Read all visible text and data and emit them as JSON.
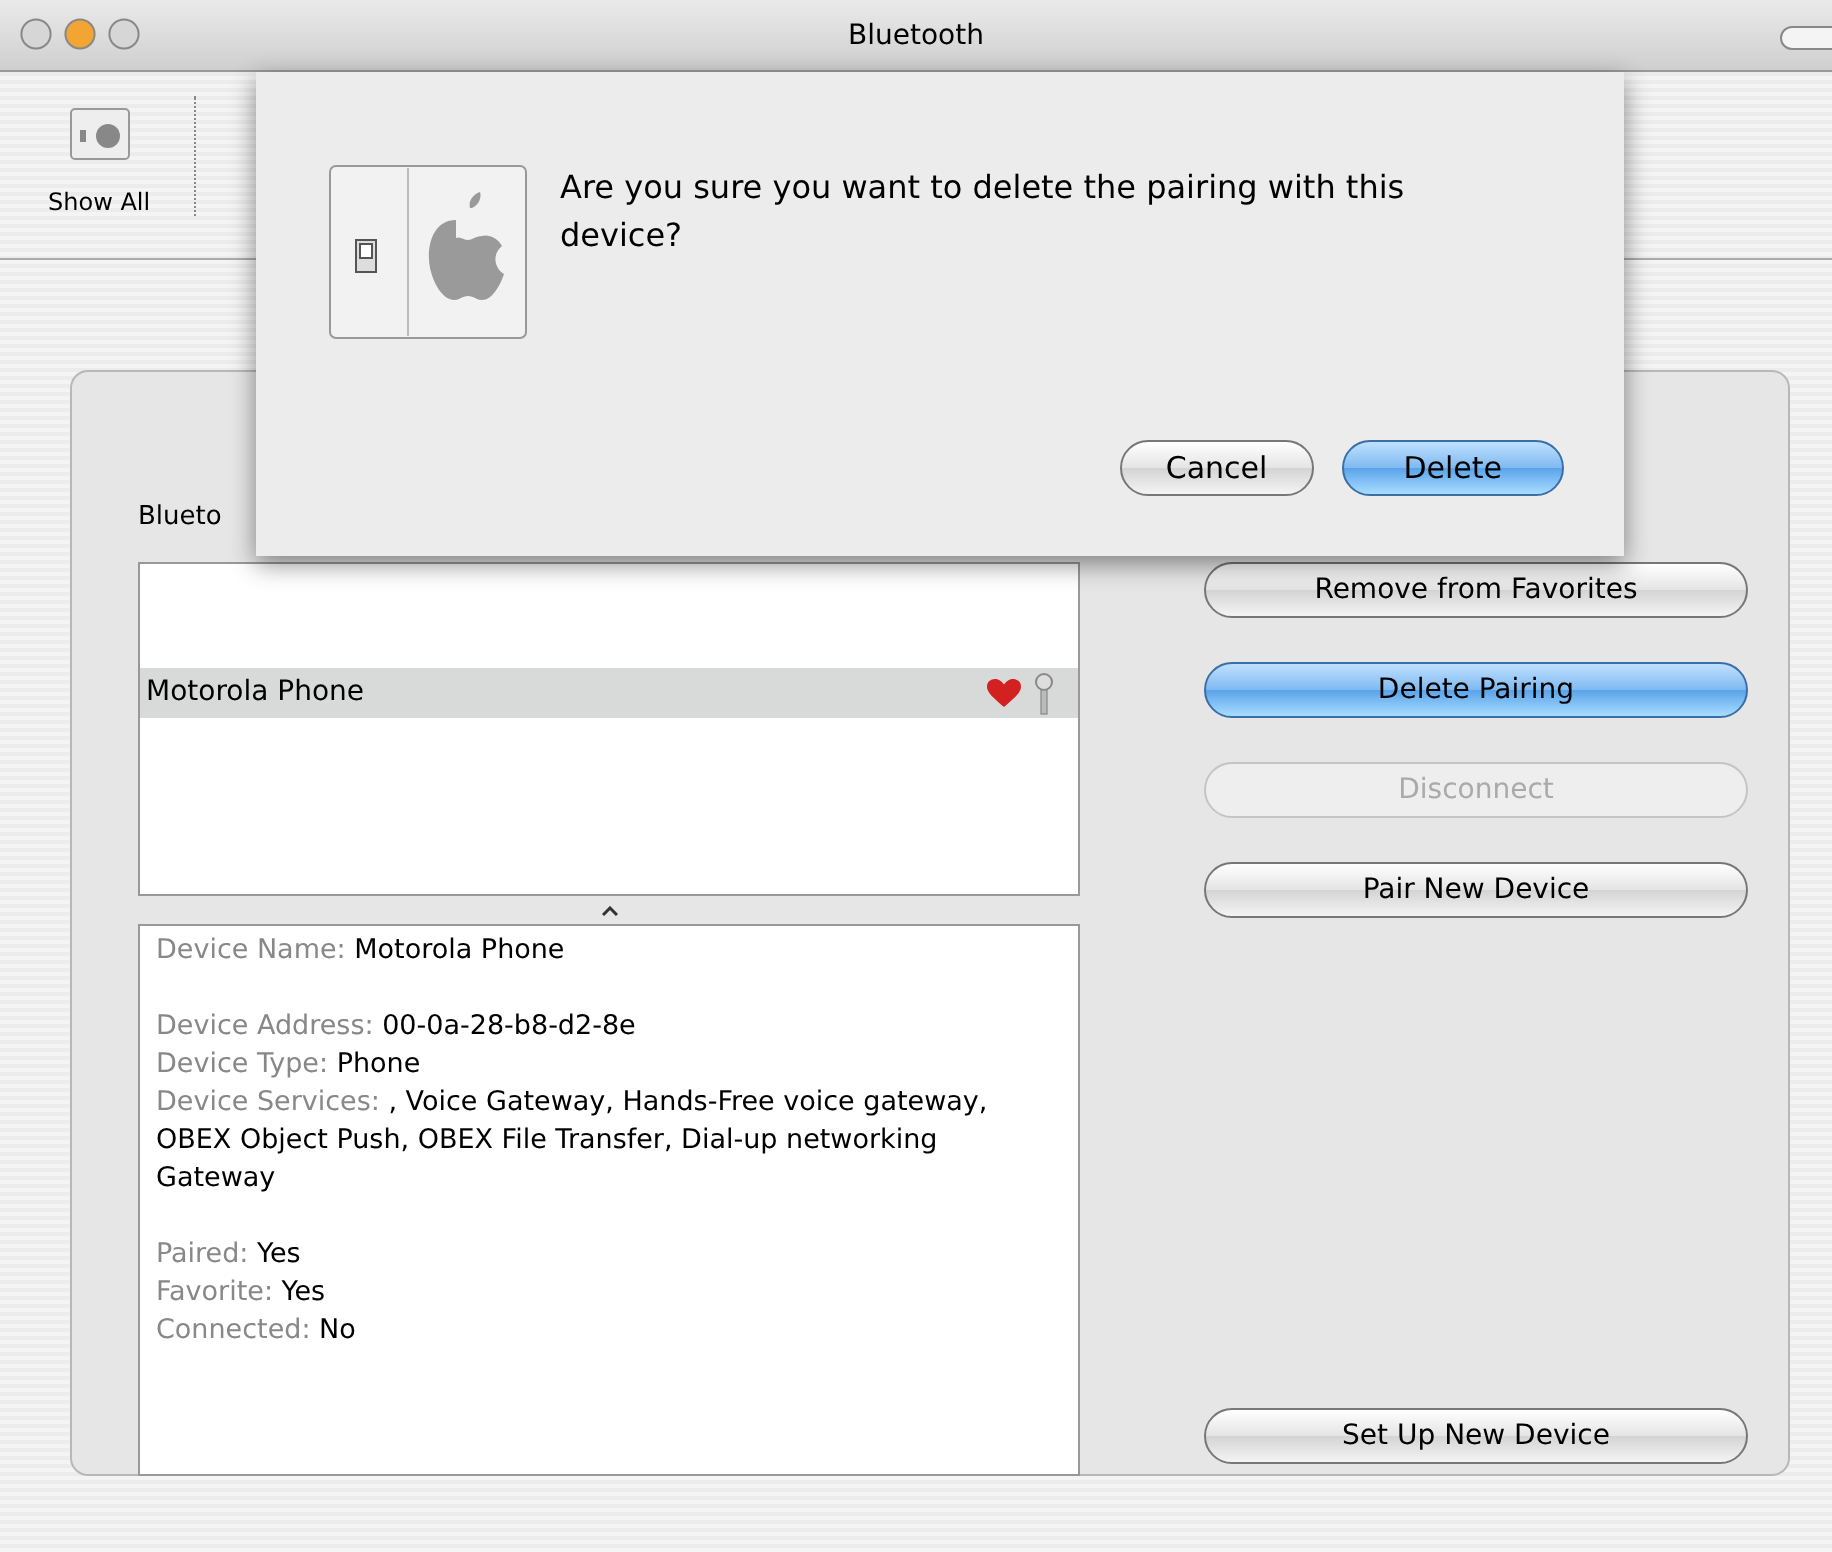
{
  "window": {
    "title": "Bluetooth"
  },
  "toolbar": {
    "items": [
      {
        "label": "Show All"
      }
    ]
  },
  "sheet": {
    "message": "Are you sure you want to delete the pairing with this device?",
    "buttons": [
      {
        "label": "Cancel",
        "default": false
      },
      {
        "label": "Delete",
        "default": true
      }
    ]
  },
  "panel": {
    "heading": "Blueto",
    "devices": [
      {
        "name": "Motorola Phone",
        "selected": true,
        "favorite": true,
        "paired": true
      }
    ],
    "details": [
      [
        {
          "label": "Device Name:",
          "value": "Motorola Phone"
        }
      ],
      [
        {
          "label": "Device Address:",
          "value": "00-0a-28-b8-d2-8e"
        },
        {
          "label": "Device Type:",
          "value": "Phone"
        },
        {
          "label": "Device Services:",
          "value": ", Voice Gateway, Hands-Free voice gateway, OBEX Object Push, OBEX File Transfer, Dial-up networking Gateway"
        }
      ],
      [
        {
          "label": "Paired:",
          "value": "Yes"
        },
        {
          "label": "Favorite:",
          "value": "Yes"
        },
        {
          "label": "Connected:",
          "value": "No"
        }
      ]
    ],
    "buttons": [
      {
        "label": "Remove from Favorites",
        "default": false,
        "disabled": false
      },
      {
        "label": "Delete Pairing",
        "default": true,
        "disabled": false
      },
      {
        "label": "Disconnect",
        "default": false,
        "disabled": true
      },
      {
        "label": "Pair New Device",
        "default": false,
        "disabled": false
      }
    ],
    "bottom_button": {
      "label": "Set Up New Device",
      "default": false,
      "disabled": false
    }
  }
}
